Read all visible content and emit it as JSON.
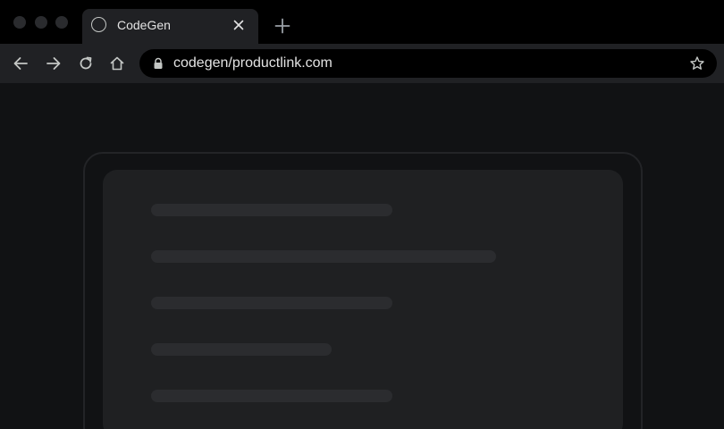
{
  "window": {
    "traffic_lights": [
      "close",
      "minimize",
      "zoom"
    ]
  },
  "tab": {
    "title": "CodeGen",
    "favicon": "globe-circle-icon",
    "close_icon": "close-icon"
  },
  "toolbar": {
    "back_icon": "arrow-left-icon",
    "forward_icon": "arrow-right-icon",
    "reload_icon": "reload-icon",
    "home_icon": "home-icon",
    "url": "codegen/productlink.com",
    "lock_icon": "lock-icon",
    "bookmark_icon": "star-icon",
    "new_tab_icon": "plus-icon"
  },
  "colors": {
    "background": "#111214",
    "tabstrip": "#000000",
    "toolbar": "#202124",
    "card": "#1f2022",
    "skeleton": "#2b2c2f",
    "text": "#e3e3e3",
    "icon": "#c4c7c5"
  },
  "skeleton_lines": 5
}
